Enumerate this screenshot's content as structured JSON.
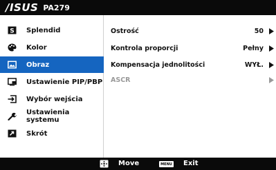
{
  "header": {
    "logo": "/ISUS",
    "model": "PA279"
  },
  "sidebar": {
    "items": [
      {
        "label": "Splendid",
        "icon": "splendid-icon"
      },
      {
        "label": "Kolor",
        "icon": "palette-icon"
      },
      {
        "label": "Obraz",
        "icon": "image-icon",
        "active": true
      },
      {
        "label": "Ustawienie PIP/PBP",
        "icon": "pip-pbp-icon"
      },
      {
        "label": "Wybór wejścia",
        "icon": "input-icon"
      },
      {
        "label": "Ustawienia systemu",
        "icon": "wrench-icon"
      },
      {
        "label": "Skrót",
        "icon": "shortcut-icon"
      }
    ]
  },
  "main": {
    "rows": [
      {
        "label": "Ostrość",
        "value": "50"
      },
      {
        "label": "Kontrola proporcji",
        "value": "Pełny"
      },
      {
        "label": "Kompensacja jednolitości",
        "value": "WYŁ."
      },
      {
        "label": "ASCR",
        "value": "",
        "disabled": true
      }
    ]
  },
  "footer": {
    "move_label": "Move",
    "menu_key": "MENU",
    "exit_label": "Exit"
  },
  "colors": {
    "accent": "#1565c0",
    "bar": "#0a0a0a",
    "disabled": "#9a9a9a"
  }
}
